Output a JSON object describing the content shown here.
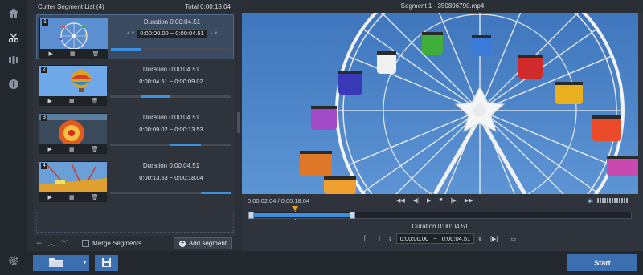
{
  "segment_list": {
    "title": "Cutter Segment List (4)",
    "total": "Total 0:00:18.04",
    "items": [
      {
        "number": "1",
        "duration": "Duration 0:00:04.51",
        "range": "0:00:00.00  ~  0:00:04.51",
        "progress_start": 0.0,
        "progress_end": 0.25,
        "active": true
      },
      {
        "number": "2",
        "duration": "Duration 0:00:04.51",
        "range": "0:00:04.51  ~  0:00:09.02",
        "progress_start": 0.25,
        "progress_end": 0.5,
        "active": false
      },
      {
        "number": "3",
        "duration": "Duration 0:00:04.51",
        "range": "0:00:09.02  ~  0:00:13.53",
        "progress_start": 0.5,
        "progress_end": 0.75,
        "active": false
      },
      {
        "number": "4",
        "duration": "Duration 0:00:04.51",
        "range": "0:00:13.53  ~  0:00:18.04",
        "progress_start": 0.75,
        "progress_end": 1.0,
        "active": false
      }
    ],
    "footer": {
      "merge_label": "Merge Segments",
      "merge_checked": false,
      "add_label": "Add segment"
    }
  },
  "preview": {
    "title": "Segment 1 - 350896790.mp4",
    "time": "0:00:02.04 / 0:00:18.04",
    "duration": "Duration 0:00:04.51",
    "range_start": "0:00:00.00",
    "range_sep": "~",
    "range_end": "0:00:04.51",
    "playhead_fraction": 0.113,
    "selection_start": 0.0,
    "selection_end": 0.25
  },
  "bottom": {
    "start_label": "Start"
  },
  "colors": {
    "accent": "#3b6fb0",
    "progress": "#3d8fe0",
    "marker": "#f0a020"
  }
}
